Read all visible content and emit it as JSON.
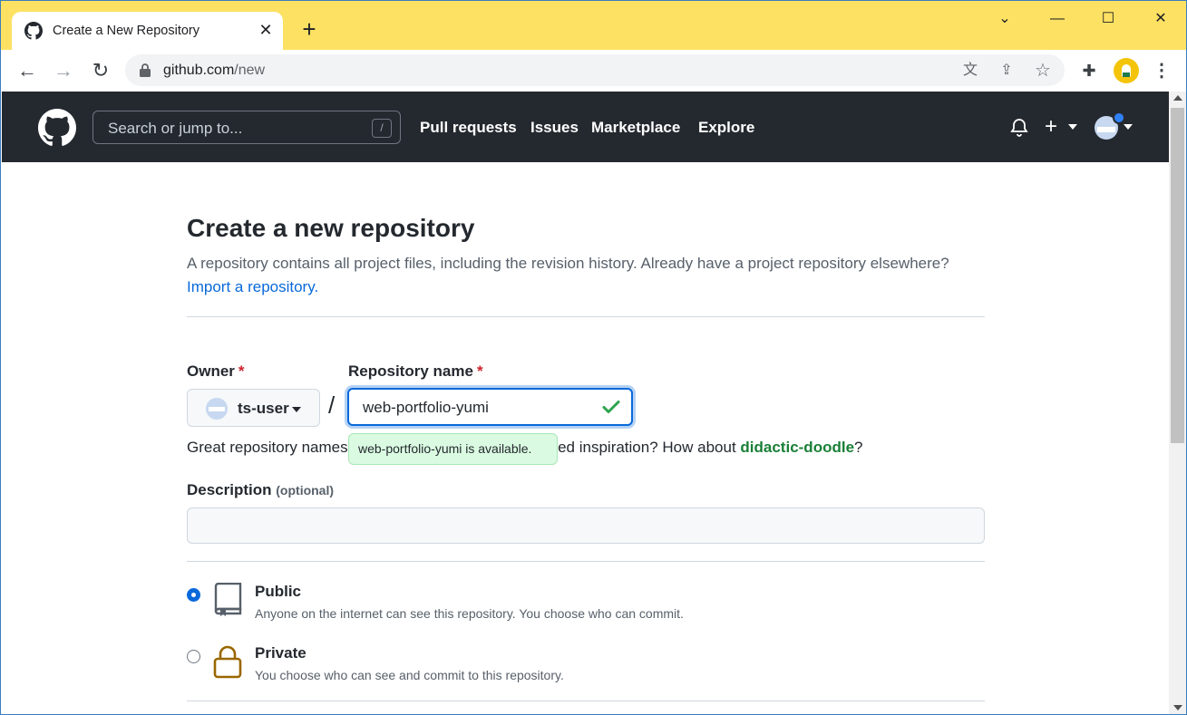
{
  "browser": {
    "tab_title": "Create a New Repository",
    "url_host": "github.com",
    "url_path": "/new",
    "window_controls": [
      "chevron-down-icon",
      "minimize-icon",
      "maximize-icon",
      "close-icon"
    ]
  },
  "gh_header": {
    "search_placeholder": "Search or jump to...",
    "search_shortcut": "/",
    "nav": [
      "Pull requests",
      "Issues",
      "Marketplace",
      "Explore"
    ],
    "plus_label": "+"
  },
  "page": {
    "title": "Create a new repository",
    "subtitle": "A repository contains all project files, including the revision history. Already have a project repository elsewhere?",
    "import_link": "Import a repository.",
    "owner_label": "Owner",
    "repo_label": "Repository name",
    "required_mark": "*",
    "owner_value": "ts-user",
    "separator": "/",
    "repo_value": "web-portfolio-yumi",
    "availability_tooltip": "web-portfolio-yumi is available.",
    "hint_prefix": "Great repository names",
    "hint_suffix": "eed inspiration? How about",
    "hint_suggestion": "didactic-doodle",
    "hint_end": "?",
    "description_label": "Description",
    "description_optional": "(optional)",
    "description_value": "",
    "visibility": [
      {
        "title": "Public",
        "desc": "Anyone on the internet can see this repository. You choose who can commit.",
        "selected": true
      },
      {
        "title": "Private",
        "desc": "You choose who can see and commit to this repository.",
        "selected": false
      }
    ]
  },
  "colors": {
    "chrome_tabbar": "#fde163",
    "gh_header": "#24292f",
    "link": "#0969da",
    "success": "#1a7f37",
    "required": "#cf222e",
    "private_icon": "#9a6700"
  }
}
